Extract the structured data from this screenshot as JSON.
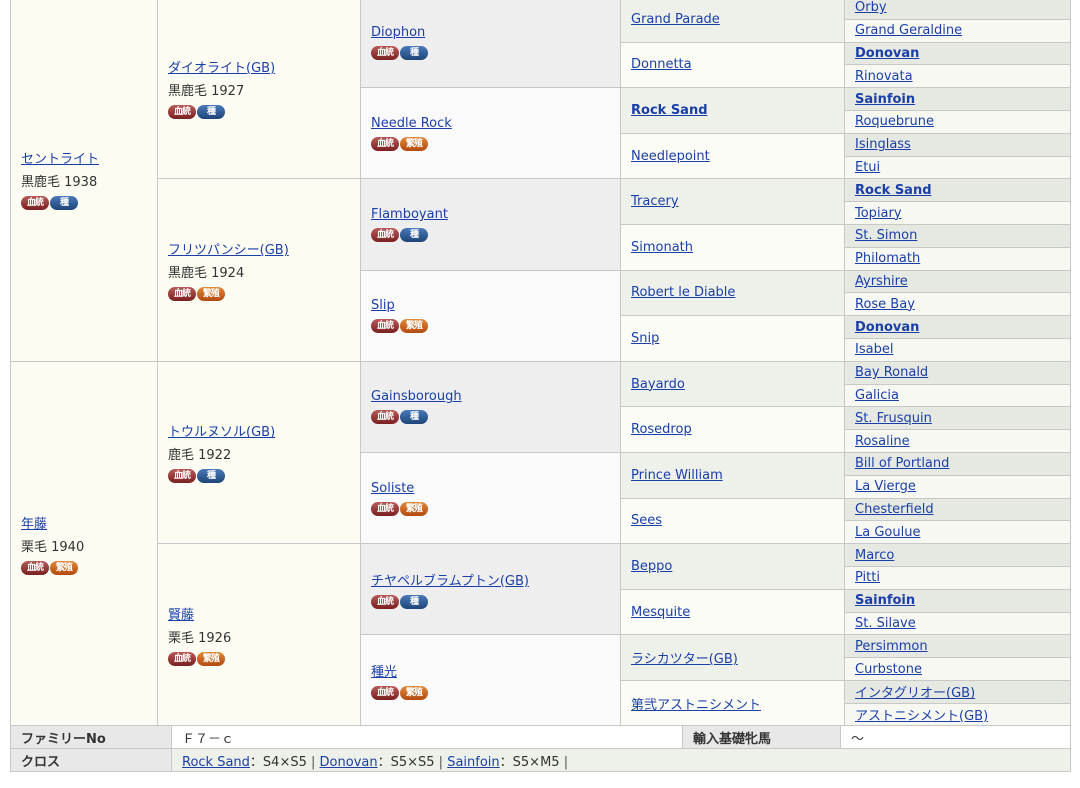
{
  "gen1": [
    {
      "name": "セントライト",
      "meta": "黒鹿毛 1938",
      "icons": [
        {
          "label": "血統",
          "type": "k"
        },
        {
          "label": "種",
          "type": "s"
        }
      ]
    },
    {
      "name": "年藤",
      "meta": "栗毛 1940",
      "icons": [
        {
          "label": "血統",
          "type": "k"
        },
        {
          "label": "繁殖",
          "type": "h"
        }
      ]
    }
  ],
  "gen2": [
    {
      "name": "ダイオライト(GB)",
      "meta": "黒鹿毛 1927",
      "icons": [
        {
          "label": "血統",
          "type": "k"
        },
        {
          "label": "種",
          "type": "s"
        }
      ]
    },
    {
      "name": "フリツパンシー(GB)",
      "meta": "黒鹿毛 1924",
      "icons": [
        {
          "label": "血統",
          "type": "k"
        },
        {
          "label": "繁殖",
          "type": "h"
        }
      ]
    },
    {
      "name": "トウルヌソル(GB)",
      "meta": "鹿毛 1922",
      "icons": [
        {
          "label": "血統",
          "type": "k"
        },
        {
          "label": "種",
          "type": "s"
        }
      ]
    },
    {
      "name": "賢藤",
      "meta": "栗毛 1926",
      "icons": [
        {
          "label": "血統",
          "type": "k"
        },
        {
          "label": "繁殖",
          "type": "h"
        }
      ]
    }
  ],
  "gen3": [
    {
      "name": "Diophon",
      "icons": [
        {
          "label": "血統",
          "type": "k"
        },
        {
          "label": "種",
          "type": "s"
        }
      ]
    },
    {
      "name": "Needle Rock",
      "icons": [
        {
          "label": "血統",
          "type": "k"
        },
        {
          "label": "繁殖",
          "type": "h"
        }
      ]
    },
    {
      "name": "Flamboyant",
      "icons": [
        {
          "label": "血統",
          "type": "k"
        },
        {
          "label": "種",
          "type": "s"
        }
      ]
    },
    {
      "name": "Slip",
      "icons": [
        {
          "label": "血統",
          "type": "k"
        },
        {
          "label": "繁殖",
          "type": "h"
        }
      ]
    },
    {
      "name": "Gainsborough",
      "icons": [
        {
          "label": "血統",
          "type": "k"
        },
        {
          "label": "種",
          "type": "s"
        }
      ]
    },
    {
      "name": "Soliste",
      "icons": [
        {
          "label": "血統",
          "type": "k"
        },
        {
          "label": "繁殖",
          "type": "h"
        }
      ]
    },
    {
      "name": "チヤペルブラムプトン(GB)",
      "icons": [
        {
          "label": "血統",
          "type": "k"
        },
        {
          "label": "種",
          "type": "s"
        }
      ]
    },
    {
      "name": "種光",
      "icons": [
        {
          "label": "血統",
          "type": "k"
        },
        {
          "label": "繁殖",
          "type": "h"
        }
      ]
    }
  ],
  "gen4": [
    {
      "name": "Grand Parade",
      "bold": false
    },
    {
      "name": "Donnetta",
      "bold": false
    },
    {
      "name": "Rock Sand",
      "bold": true
    },
    {
      "name": "Needlepoint",
      "bold": false
    },
    {
      "name": "Tracery",
      "bold": false
    },
    {
      "name": "Simonath",
      "bold": false
    },
    {
      "name": "Robert le Diable",
      "bold": false
    },
    {
      "name": "Snip",
      "bold": false
    },
    {
      "name": "Bayardo",
      "bold": false
    },
    {
      "name": "Rosedrop",
      "bold": false
    },
    {
      "name": "Prince William",
      "bold": false
    },
    {
      "name": "Sees",
      "bold": false
    },
    {
      "name": "Beppo",
      "bold": false
    },
    {
      "name": "Mesquite",
      "bold": false
    },
    {
      "name": "ラシカツター(GB)",
      "bold": false
    },
    {
      "name": "第弐アストニシメント",
      "bold": false
    }
  ],
  "gen5": [
    {
      "name": "Orby",
      "bold": false
    },
    {
      "name": "Grand Geraldine",
      "bold": false
    },
    {
      "name": "Donovan",
      "bold": true
    },
    {
      "name": "Rinovata",
      "bold": false
    },
    {
      "name": "Sainfoin",
      "bold": true
    },
    {
      "name": "Roquebrune",
      "bold": false
    },
    {
      "name": "Isinglass",
      "bold": false
    },
    {
      "name": "Etui",
      "bold": false
    },
    {
      "name": "Rock Sand",
      "bold": true
    },
    {
      "name": "Topiary",
      "bold": false
    },
    {
      "name": "St. Simon",
      "bold": false
    },
    {
      "name": "Philomath",
      "bold": false
    },
    {
      "name": "Ayrshire",
      "bold": false
    },
    {
      "name": "Rose Bay",
      "bold": false
    },
    {
      "name": "Donovan",
      "bold": true
    },
    {
      "name": "Isabel",
      "bold": false
    },
    {
      "name": "Bay Ronald",
      "bold": false
    },
    {
      "name": "Galicia",
      "bold": false
    },
    {
      "name": "St. Frusquin",
      "bold": false
    },
    {
      "name": "Rosaline",
      "bold": false
    },
    {
      "name": "Bill of Portland",
      "bold": false
    },
    {
      "name": "La Vierge",
      "bold": false
    },
    {
      "name": "Chesterfield",
      "bold": false
    },
    {
      "name": "La Goulue",
      "bold": false
    },
    {
      "name": "Marco",
      "bold": false
    },
    {
      "name": "Pitti",
      "bold": false
    },
    {
      "name": "Sainfoin",
      "bold": true
    },
    {
      "name": "St. Silave",
      "bold": false
    },
    {
      "name": "Persimmon",
      "bold": false
    },
    {
      "name": "Curbstone",
      "bold": false
    },
    {
      "name": "インタグリオー(GB)",
      "bold": false
    },
    {
      "name": "アストニシメント(GB)",
      "bold": false
    }
  ],
  "info": {
    "family_label": "ファミリーNo",
    "family_value": "Ｆ７－ｃ",
    "import_label": "輸入基礎牝馬",
    "import_value": "～",
    "cross_label": "クロス",
    "cross": [
      {
        "name": "Rock Sand",
        "detail": "：S4×S5"
      },
      {
        "name": "Donovan",
        "detail": "：S5×S5"
      },
      {
        "name": "Sainfoin",
        "detail": "：S5×M5"
      }
    ],
    "cross_sep": "|"
  }
}
